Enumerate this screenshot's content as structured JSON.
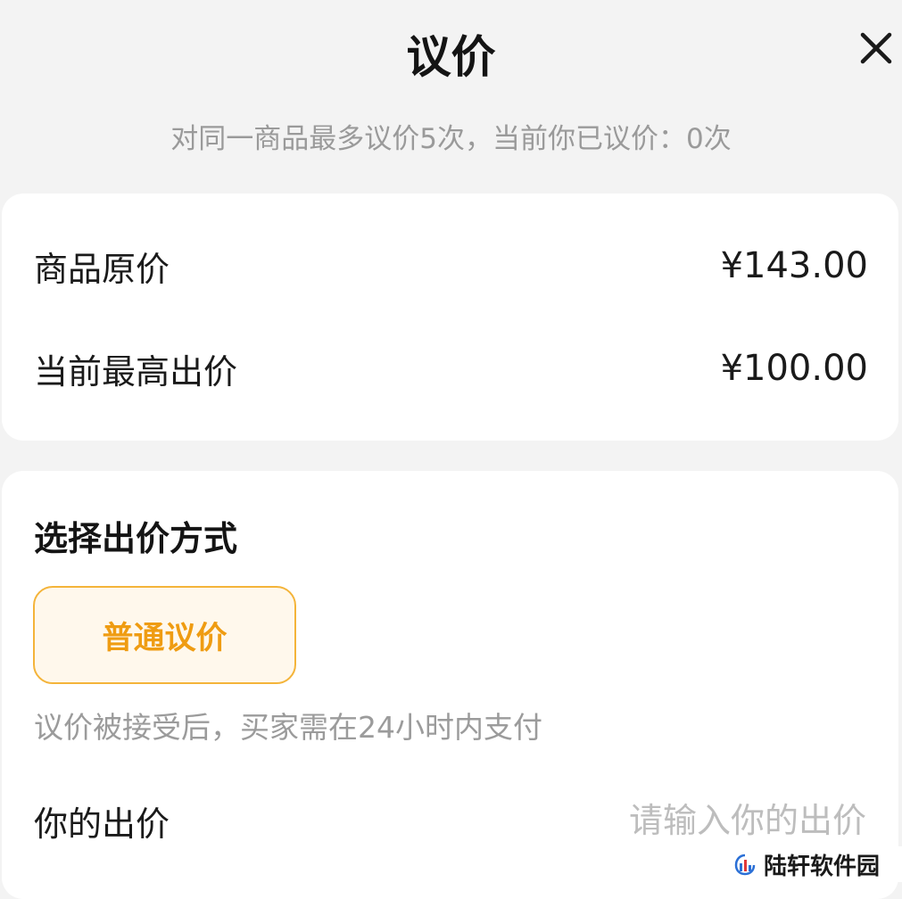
{
  "header": {
    "title": "议价"
  },
  "subtitle": "对同一商品最多议价5次，当前你已议价：0次",
  "price_info": {
    "original_label": "商品原价",
    "original_value": "¥143.00",
    "highest_label": "当前最高出价",
    "highest_value": "¥100.00"
  },
  "method": {
    "title": "选择出价方式",
    "options": [
      {
        "label": "普通议价",
        "selected": true
      }
    ],
    "hint": "议价被接受后，买家需在24小时内支付"
  },
  "offer": {
    "label": "你的出价",
    "value": "",
    "placeholder": "请输入你的出价"
  },
  "watermark": {
    "text": "陆轩软件园"
  },
  "colors": {
    "accent": "#ef9c12",
    "accent_border": "#f4b43a",
    "accent_bg": "#fff8ec",
    "page_bg": "#f3f3f3"
  }
}
